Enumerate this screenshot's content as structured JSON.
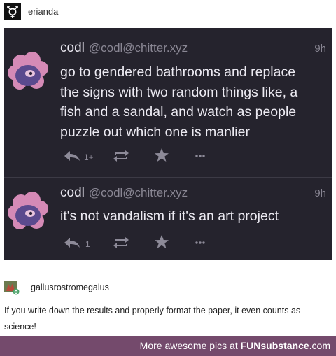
{
  "header": {
    "username": "erianda"
  },
  "posts": [
    {
      "display_name": "codl",
      "handle": "@codl@chitter.xyz",
      "time": "9h",
      "text_lines": [
        "go to gendered bathrooms and replace",
        "the signs with two random things like, a",
        "fish and a sandal, and watch as people",
        "puzzle out which one is manlier"
      ],
      "reply_count": "1+"
    },
    {
      "display_name": "codl",
      "handle": "@codl@chitter.xyz",
      "time": "9h",
      "text_lines": [
        "it's not vandalism if it's an art project"
      ],
      "reply_count": "1"
    }
  ],
  "reblog": {
    "username": "gallusrostromegalus",
    "text": "If you write down the results and properly format the paper, it even counts as science!"
  },
  "footer": {
    "prefix": "More awesome pics at",
    "brand": "FUNsubstance",
    "suffix": ".com"
  },
  "colors": {
    "panel_bg": "#25232d",
    "footer_bg": "#744a6c",
    "avatar_pink": "#d58ab6",
    "avatar_purple": "#5b4a8e"
  }
}
